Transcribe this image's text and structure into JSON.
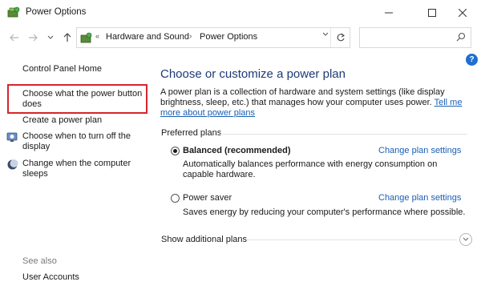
{
  "window": {
    "title": "Power Options"
  },
  "address": {
    "crumbs": [
      "Hardware and Sound",
      "Power Options"
    ],
    "chevron": "«",
    "separator": "›",
    "search_placeholder": ""
  },
  "help_label": "?",
  "sidebar": {
    "items": [
      {
        "label": "Control Panel Home"
      },
      {
        "label": "Choose what the power button does",
        "highlighted": true
      },
      {
        "label": "Create a power plan"
      },
      {
        "label": "Choose when to turn off the display",
        "icon": "monitor-power-icon"
      },
      {
        "label": "Change when the computer sleeps",
        "icon": "moon-sleep-icon"
      }
    ],
    "see_also": "See also",
    "see_also_items": [
      {
        "label": "User Accounts"
      }
    ]
  },
  "main": {
    "heading": "Choose or customize a power plan",
    "description": "A power plan is a collection of hardware and system settings (like display brightness, sleep, etc.) that manages how your computer uses power.",
    "description_link": "Tell me more about power plans",
    "preferred_label": "Preferred plans",
    "plans": [
      {
        "name": "Balanced (recommended)",
        "selected": true,
        "settings_link": "Change plan settings",
        "description_lines": [
          "Automatically balances performance with energy consumption on",
          "capable hardware."
        ]
      },
      {
        "name": "Power saver",
        "selected": false,
        "settings_link": "Change plan settings",
        "description_lines": [
          "Saves energy by reducing your computer's performance where possible."
        ]
      }
    ],
    "show_additional": "Show additional plans"
  },
  "colors": {
    "heading": "#1e3a78",
    "link": "#1a5fb4",
    "highlight_border": "#d6252c",
    "help_badge": "#1f6fd0"
  }
}
